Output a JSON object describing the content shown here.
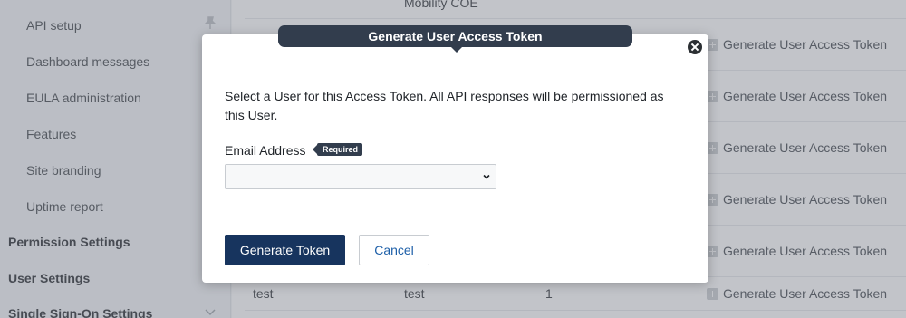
{
  "sidebar": {
    "items": [
      {
        "label": "API setup"
      },
      {
        "label": "Dashboard messages"
      },
      {
        "label": "EULA administration"
      },
      {
        "label": "Features"
      },
      {
        "label": "Site branding"
      },
      {
        "label": "Uptime report"
      }
    ],
    "sections": [
      {
        "label": "Permission Settings"
      },
      {
        "label": "User Settings"
      },
      {
        "label": "Single Sign-On Settings"
      }
    ]
  },
  "table": {
    "top_cell": "Mobility COE",
    "last_row": {
      "name": "test",
      "description": "test",
      "count": "1"
    },
    "row_action_label": "Generate User Access Token"
  },
  "modal": {
    "title": "Generate User Access Token",
    "description": "Select a User for this Access Token. All API responses will be permissioned as this User.",
    "email_label": "Email Address",
    "required_badge": "Required",
    "email_value": "",
    "generate_button": "Generate Token",
    "cancel_button": "Cancel"
  }
}
